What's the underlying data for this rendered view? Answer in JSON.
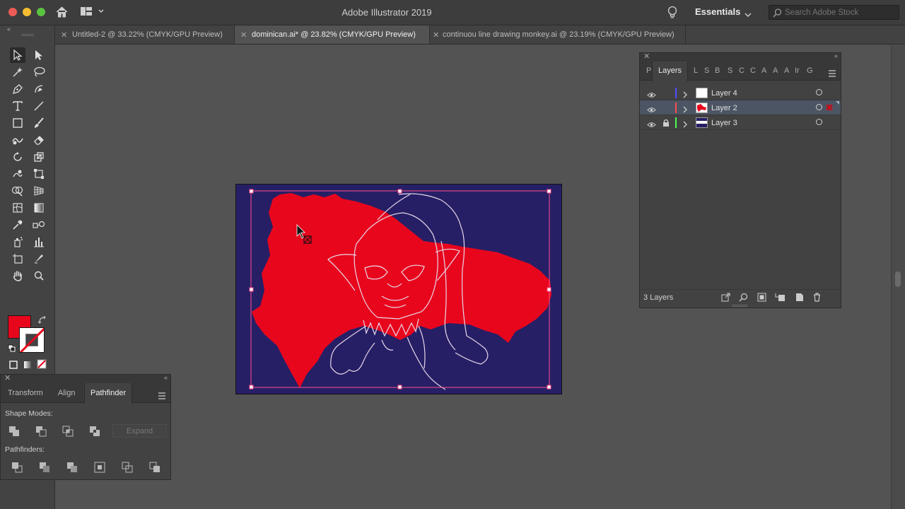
{
  "app": {
    "title": "Adobe Illustrator 2019",
    "workspace": "Essentials",
    "search_placeholder": "Search Adobe Stock"
  },
  "tabs": [
    {
      "label": "Untitled-2 @ 33.22% (CMYK/GPU Preview)",
      "active": false
    },
    {
      "label": "dominican.ai* @ 23.82% (CMYK/GPU Preview)",
      "active": true
    },
    {
      "label": "continuou line drawing monkey.ai @ 23.19% (CMYK/GPU Preview)",
      "active": false
    }
  ],
  "toolbar": {
    "tools": [
      "selection-tool",
      "direct-selection-tool",
      "magic-wand-tool",
      "lasso-tool",
      "pen-tool",
      "curvature-tool",
      "type-tool",
      "line-segment-tool",
      "rectangle-tool",
      "paintbrush-tool",
      "shaper-tool",
      "eraser-tool",
      "rotate-tool",
      "scale-tool",
      "warp-tool",
      "free-transform-tool",
      "shape-builder-tool",
      "perspective-grid-tool",
      "mesh-tool",
      "gradient-tool",
      "eyedropper-tool",
      "blend-tool",
      "symbol-sprayer-tool",
      "column-graph-tool",
      "artboard-tool",
      "slice-tool",
      "hand-tool",
      "zoom-tool"
    ],
    "fill_color": "#e8061d",
    "stroke_color": "none"
  },
  "layers_panel": {
    "tabs": [
      "P",
      "Layers",
      "L",
      "S",
      "B",
      "S",
      "C",
      "C",
      "A",
      "A",
      "A",
      "Ir",
      "G"
    ],
    "active_tab": "Layers",
    "layers": [
      {
        "name": "Layer 4",
        "color": "#4f4fff",
        "visible": true,
        "locked": false,
        "selected": false
      },
      {
        "name": "Layer 2",
        "color": "#ff4f4f",
        "visible": true,
        "locked": false,
        "selected": true
      },
      {
        "name": "Layer 3",
        "color": "#4fff4f",
        "visible": true,
        "locked": true,
        "selected": false
      }
    ],
    "count_label": "3 Layers"
  },
  "pathfinder_panel": {
    "tabs": [
      "Transform",
      "Align",
      "Pathfinder"
    ],
    "active_tab": "Pathfinder",
    "shape_modes_label": "Shape Modes:",
    "expand_label": "Expand",
    "pathfinders_label": "Pathfinders:"
  },
  "colors": {
    "artboard_bg": "#261f66",
    "map_fill": "#e8061d",
    "line_art": "#d9d4ff",
    "selection": "#ff4f8a"
  }
}
